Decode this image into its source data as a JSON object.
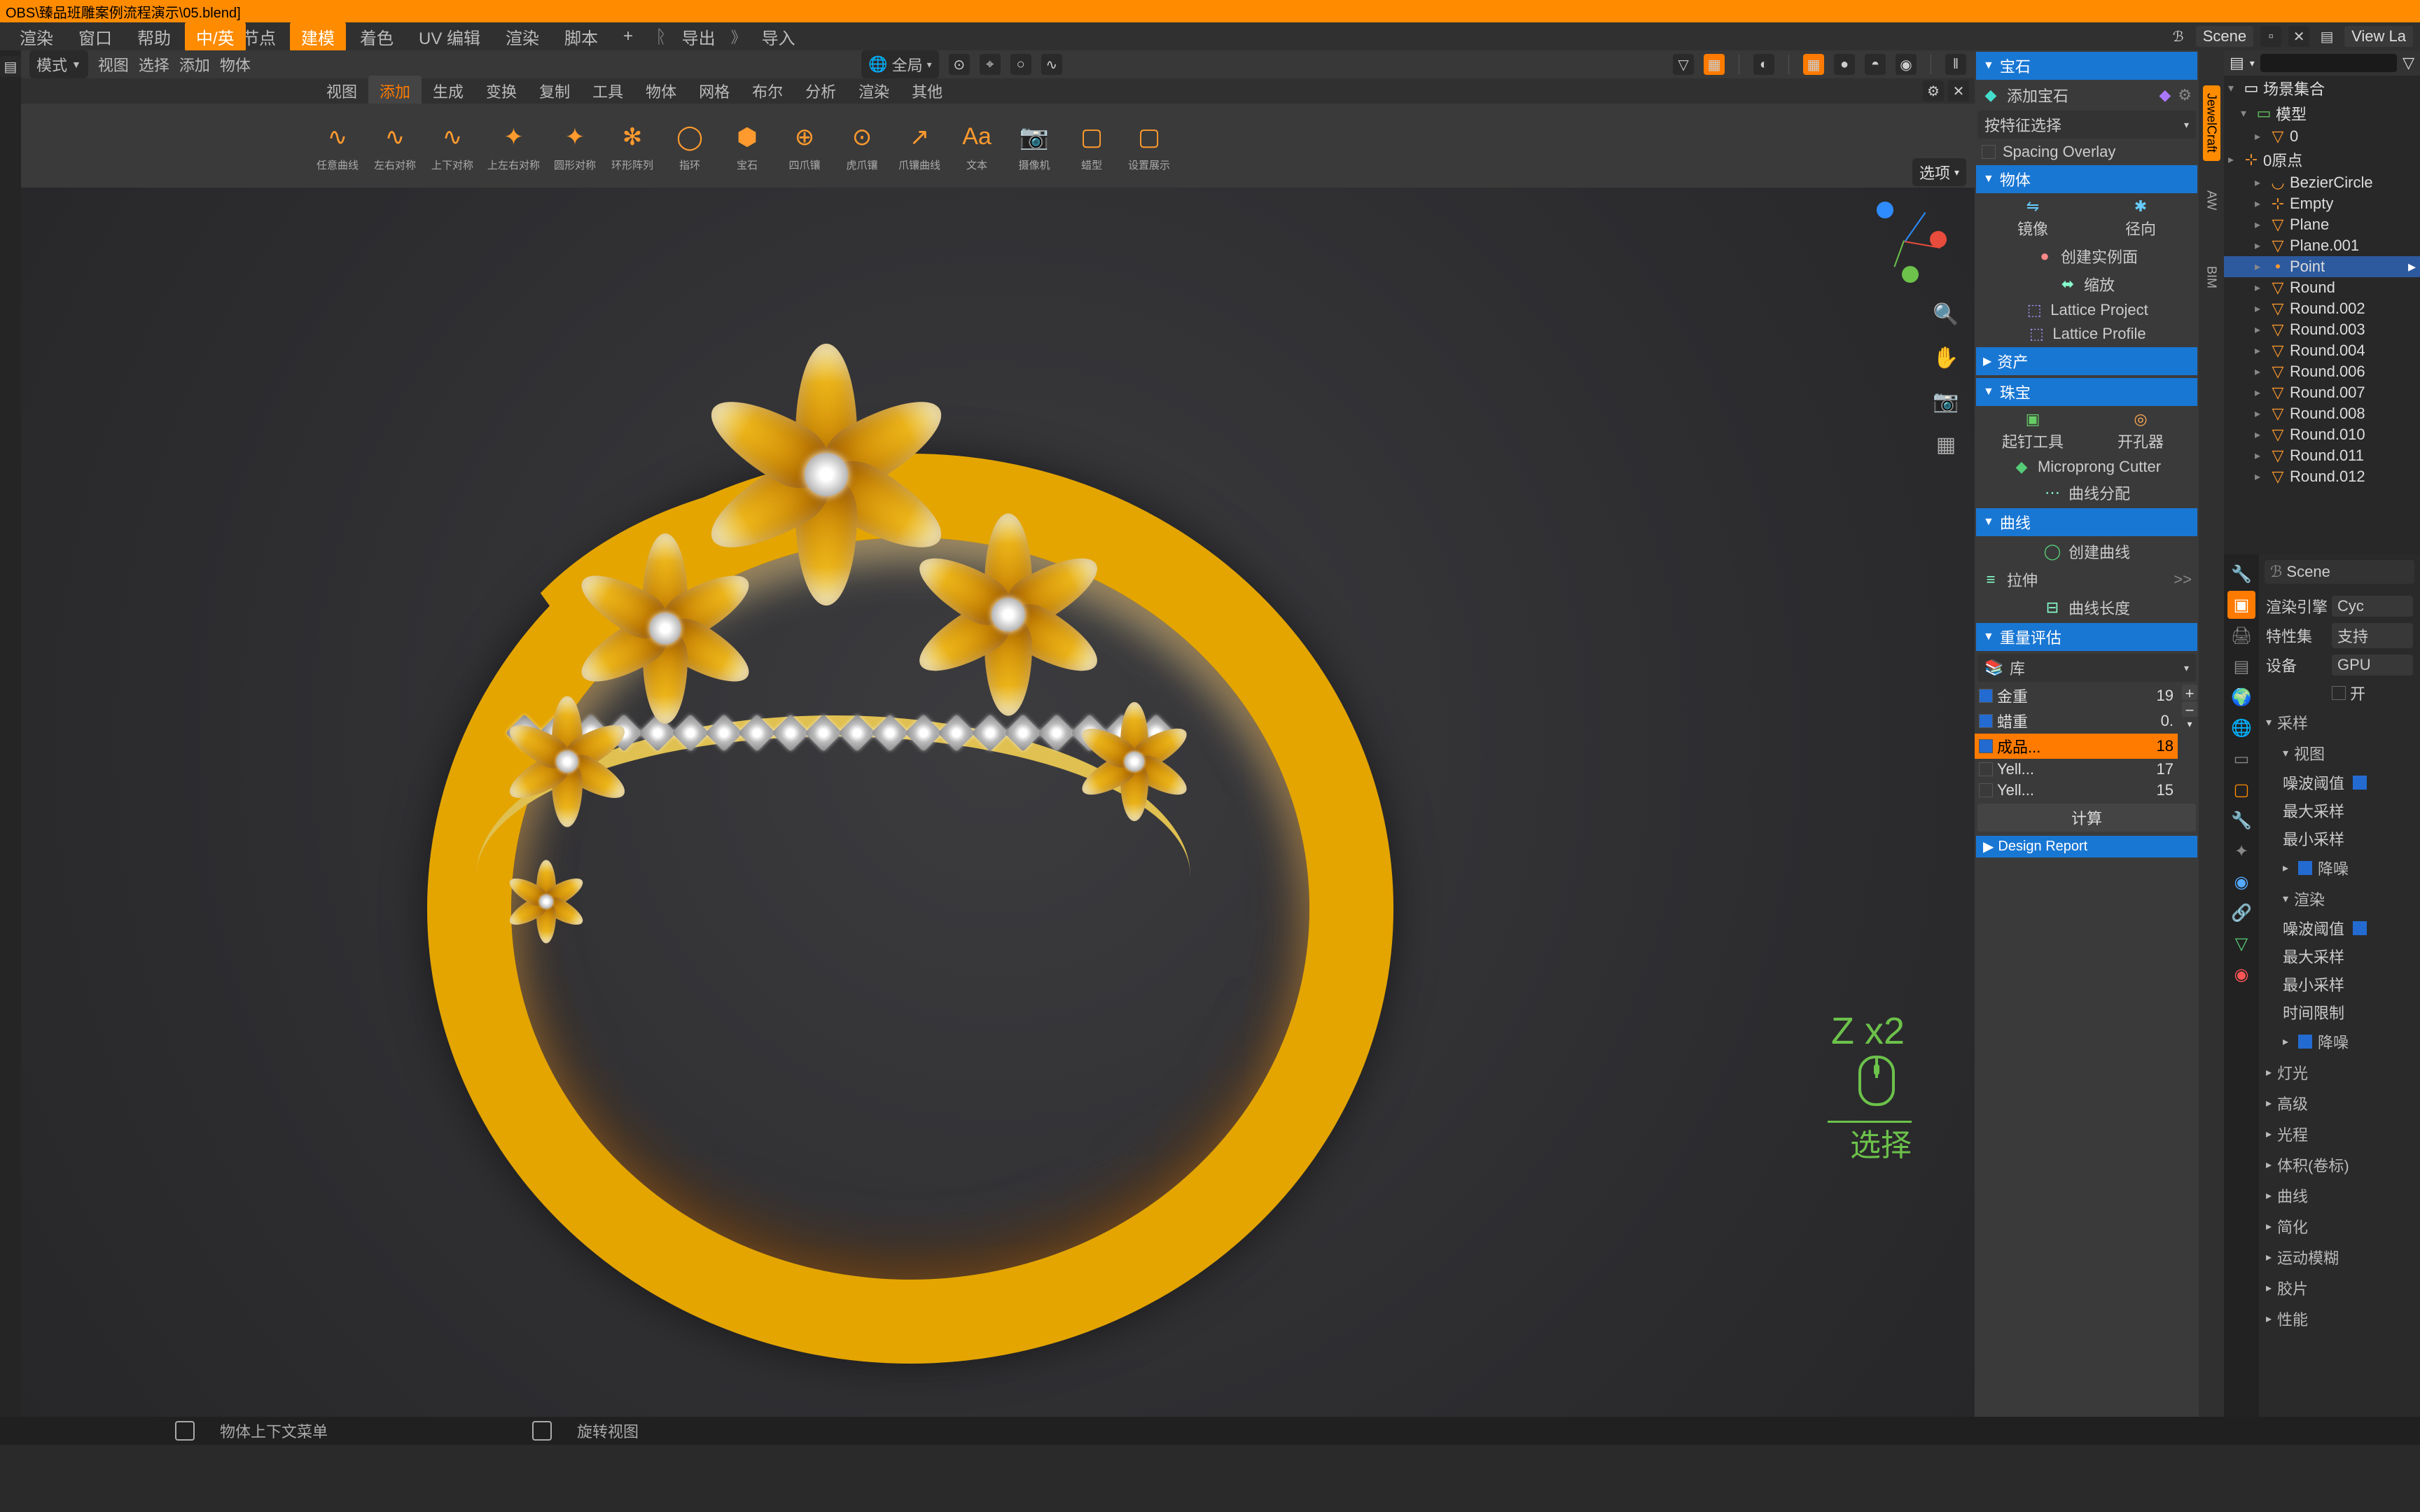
{
  "title": "OBS\\臻品班雕案例流程演示\\05.blend]",
  "menubar": [
    "渲染",
    "窗口",
    "帮助"
  ],
  "lang_toggle": "中/英",
  "workspace_tabs": [
    "几何节点",
    "建模",
    "着色",
    "UV 编辑",
    "渲染",
    "脚本",
    "+"
  ],
  "workspace_active": 1,
  "import_export": {
    "export": "导出",
    "import": "导入"
  },
  "scene_label": "Scene",
  "viewlayer_label": "View La",
  "vp": {
    "mode": "模式",
    "menus": [
      "视图",
      "选择",
      "添加",
      "物体"
    ],
    "global": "全局",
    "shelf_tabs": [
      "视图",
      "添加",
      "生成",
      "变换",
      "复制",
      "工具",
      "物体",
      "网格",
      "布尔",
      "分析",
      "渲染",
      "其他"
    ],
    "shelf_active": 1,
    "options_label": "选项",
    "shelf_items": [
      {
        "l": "任意曲线",
        "i": "∿"
      },
      {
        "l": "左右对称",
        "i": "∿"
      },
      {
        "l": "上下对称",
        "i": "∿"
      },
      {
        "l": "上左右对称",
        "i": "✦"
      },
      {
        "l": "圆形对称",
        "i": "✦"
      },
      {
        "l": "环形阵列",
        "i": "✻"
      },
      {
        "l": "指环",
        "i": "◯"
      },
      {
        "l": "宝石",
        "i": "⬢"
      },
      {
        "l": "四爪镶",
        "i": "⊕"
      },
      {
        "l": "虎爪镶",
        "i": "⊙"
      },
      {
        "l": "爪镶曲线",
        "i": "↗"
      },
      {
        "l": "文本",
        "i": "Aa"
      },
      {
        "l": "摄像机",
        "i": "📷"
      },
      {
        "l": "蜡型",
        "i": "▢"
      },
      {
        "l": "设置展示",
        "i": "▢"
      }
    ],
    "hud": {
      "zx": "Z x2",
      "select": "选择"
    }
  },
  "jc": {
    "gem": {
      "hdr": "宝石",
      "add": "添加宝石",
      "sel": "按特征选择",
      "overlay": "Spacing Overlay"
    },
    "obj": {
      "hdr": "物体",
      "mirror": "镜像",
      "radial": "径向",
      "inst": "创建实例面",
      "scale": "缩放",
      "lp": "Lattice Project",
      "lf": "Lattice Profile"
    },
    "asset": {
      "hdr": "资产"
    },
    "jewel": {
      "hdr": "珠宝",
      "nail": "起钉工具",
      "hole": "开孔器",
      "mp": "Microprong Cutter",
      "cv": "曲线分配"
    },
    "curve": {
      "hdr": "曲线",
      "create": "创建曲线",
      "extrude": "拉伸",
      "len": "曲线长度"
    },
    "weight": {
      "hdr": "重量评估",
      "lib": "库",
      "rows": [
        {
          "on": true,
          "name": "金重",
          "val": "19"
        },
        {
          "on": true,
          "name": "蜡重",
          "val": "0."
        },
        {
          "on": true,
          "name": "成品...",
          "val": "18",
          "hl": true
        },
        {
          "on": false,
          "name": "Yell...",
          "val": "17"
        },
        {
          "on": false,
          "name": "Yell...",
          "val": "15"
        }
      ],
      "calc": "计算"
    },
    "report": {
      "hdr": "Design Report"
    },
    "sidetabs": [
      "JewelCraft",
      "AW",
      "BIM"
    ]
  },
  "outliner": {
    "top": "场景集合",
    "root": "模型",
    "items": [
      {
        "n": "0",
        "ic": "▽",
        "d": 2
      },
      {
        "n": "0原点",
        "ic": "⊹",
        "d": 3
      },
      {
        "n": "BezierCircle",
        "ic": "◡",
        "d": 2
      },
      {
        "n": "Empty",
        "ic": "⊹",
        "d": 2
      },
      {
        "n": "Plane",
        "ic": "▽",
        "d": 2
      },
      {
        "n": "Plane.001",
        "ic": "▽",
        "d": 2
      },
      {
        "n": "Point",
        "ic": "•",
        "d": 2,
        "sel": true
      },
      {
        "n": "Round",
        "ic": "▽",
        "d": 2
      },
      {
        "n": "Round.002",
        "ic": "▽",
        "d": 2
      },
      {
        "n": "Round.003",
        "ic": "▽",
        "d": 2
      },
      {
        "n": "Round.004",
        "ic": "▽",
        "d": 2
      },
      {
        "n": "Round.006",
        "ic": "▽",
        "d": 2
      },
      {
        "n": "Round.007",
        "ic": "▽",
        "d": 2
      },
      {
        "n": "Round.008",
        "ic": "▽",
        "d": 2
      },
      {
        "n": "Round.010",
        "ic": "▽",
        "d": 2
      },
      {
        "n": "Round.011",
        "ic": "▽",
        "d": 2
      },
      {
        "n": "Round.012",
        "ic": "▽",
        "d": 2
      }
    ]
  },
  "props": {
    "scene": "Scene",
    "engine_l": "渲染引擎",
    "engine_v": "Cyc",
    "feat_l": "特性集",
    "feat_v": "支持",
    "device_l": "设备",
    "device_v": "GPU",
    "open": "开",
    "sample": "采样",
    "viewport": "视图",
    "noise_th": "噪波阈值",
    "max_s": "最大采样",
    "min_s": "最小采样",
    "denoise": "降噪",
    "render": "渲染",
    "time": "时间限制",
    "sections": [
      "降噪",
      "灯光",
      "高级",
      "光程",
      "体积(卷标)",
      "曲线",
      "简化",
      "运动模糊",
      "胶片",
      "性能"
    ]
  },
  "status": {
    "ctx": "物体上下文菜单",
    "view": "旋转视图"
  }
}
